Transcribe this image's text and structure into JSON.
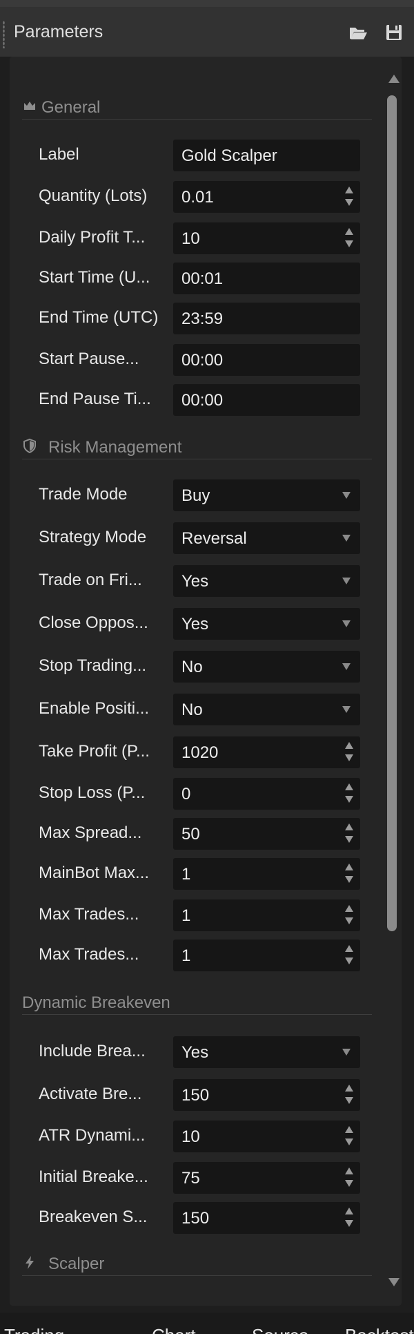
{
  "header": {
    "title": "Parameters",
    "icons": [
      "folder-open-icon",
      "save-icon"
    ]
  },
  "sections": {
    "general": {
      "label": "General",
      "icon": "crown-icon"
    },
    "risk": {
      "label": "Risk Management",
      "icon": "shield-icon"
    },
    "breakeven": {
      "label": "Dynamic Breakeven"
    },
    "scalper": {
      "label": "Scalper",
      "icon": "lightning-icon"
    }
  },
  "general": [
    {
      "label": "Label",
      "value": "Gold Scalper",
      "kind": "text"
    },
    {
      "label": "Quantity (Lots)",
      "value": "0.01",
      "kind": "number"
    },
    {
      "label": "Daily Profit T...",
      "value": "10",
      "kind": "number"
    },
    {
      "label": "Start Time (U...",
      "value": "00:01",
      "kind": "text"
    },
    {
      "label": "End Time (UTC)",
      "value": "23:59",
      "kind": "text"
    },
    {
      "label": "Start Pause...",
      "value": "00:00",
      "kind": "text"
    },
    {
      "label": "End Pause Ti...",
      "value": "00:00",
      "kind": "text"
    }
  ],
  "risk": [
    {
      "label": "Trade Mode",
      "value": "Buy",
      "kind": "select"
    },
    {
      "label": "Strategy  Mode",
      "value": "Reversal",
      "kind": "select"
    },
    {
      "label": "Trade on Fri...",
      "value": "Yes",
      "kind": "select"
    },
    {
      "label": "Close Oppos...",
      "value": "Yes",
      "kind": "select"
    },
    {
      "label": "Stop Trading...",
      "value": "No",
      "kind": "select"
    },
    {
      "label": "Enable Positi...",
      "value": "No",
      "kind": "select"
    },
    {
      "label": "Take Profit (P...",
      "value": "1020",
      "kind": "number"
    },
    {
      "label": "Stop Loss (P...",
      "value": "0",
      "kind": "number"
    },
    {
      "label": "Max Spread...",
      "value": "50",
      "kind": "number"
    },
    {
      "label": "MainBot Max...",
      "value": "1",
      "kind": "number"
    },
    {
      "label": "Max Trades...",
      "value": "1",
      "kind": "number"
    },
    {
      "label": "Max Trades...",
      "value": "1",
      "kind": "number"
    }
  ],
  "breakeven": [
    {
      "label": "Include Brea...",
      "value": "Yes",
      "kind": "select"
    },
    {
      "label": "Activate Bre...",
      "value": "150",
      "kind": "number"
    },
    {
      "label": "ATR Dynami...",
      "value": "10",
      "kind": "number"
    },
    {
      "label": "Initial Breake...",
      "value": "75",
      "kind": "number"
    },
    {
      "label": "Breakeven S...",
      "value": "150",
      "kind": "number"
    }
  ],
  "bottom_tabs": [
    "Trading",
    "Chart",
    "Source",
    "Backtesting"
  ]
}
